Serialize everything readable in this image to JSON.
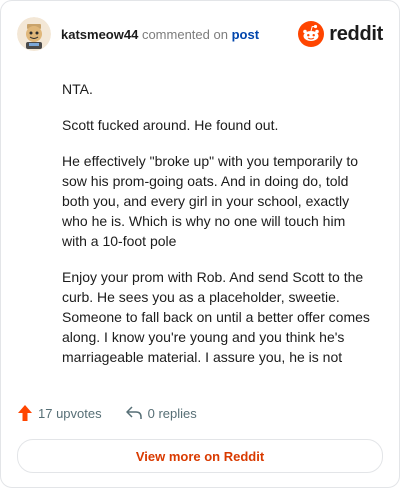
{
  "header": {
    "username": "katsmeow44",
    "action_text": "commented on",
    "post_link": "post",
    "logo_text": "reddit"
  },
  "comment": {
    "paragraphs": [
      "NTA.",
      "Scott fucked around. He found out.",
      "He effectively \"broke up\" with you temporarily to sow his prom-going oats. And in doing do, told both you, and every girl in your school, exactly who he is. Which is why no one will touch him with a 10-foot pole",
      "Enjoy your prom with Rob. And send Scott to the curb. He sees you as a placeholder, sweetie. Someone to fall back on until a better offer comes along. I know you're young and you think he's marriageable material. I assure you, he is not"
    ]
  },
  "footer": {
    "upvotes": "17 upvotes",
    "replies": "0 replies",
    "view_more": "View more on Reddit"
  },
  "colors": {
    "brand": "#ff4500",
    "link": "#0045ac",
    "view_more": "#d93a00",
    "upvote_icon": "#ff4500"
  },
  "icons": {
    "avatar": "snoo-avatar-icon",
    "logo": "reddit-snoo-icon",
    "upvote": "upvote-arrow-icon",
    "reply": "reply-arrow-icon"
  }
}
